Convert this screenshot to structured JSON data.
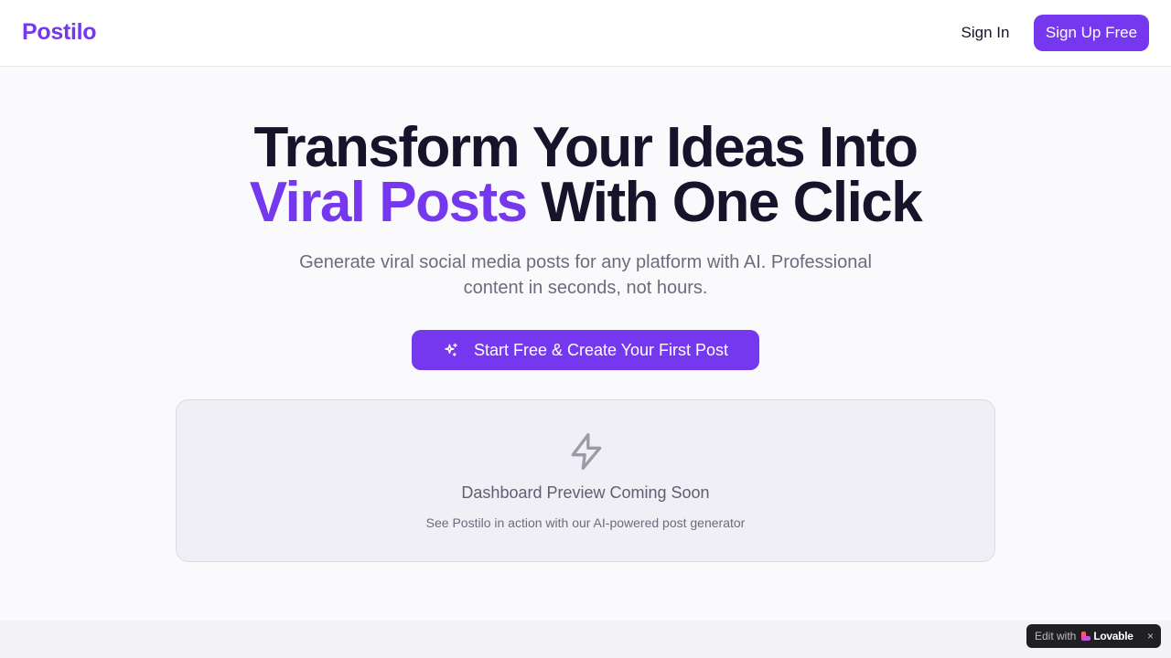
{
  "header": {
    "logo": "Postilo",
    "signin_label": "Sign In",
    "signup_label": "Sign Up Free"
  },
  "hero": {
    "title_line1": "Transform Your Ideas Into",
    "title_accent": "Viral Posts",
    "title_rest": " With One Click",
    "subtitle": "Generate viral social media posts for any platform with AI. Professional content in seconds, not hours.",
    "cta_label": "Start Free & Create Your First Post",
    "cta_icon": "sparkle-icon"
  },
  "preview": {
    "icon": "bolt-icon",
    "title": "Dashboard Preview Coming Soon",
    "subtitle": "See Postilo in action with our AI-powered post generator"
  },
  "badge": {
    "edit_label": "Edit with",
    "brand": "Lovable",
    "close": "×"
  },
  "colors": {
    "accent": "#7538ee",
    "text": "#16132b",
    "muted": "#6b6b7d"
  }
}
